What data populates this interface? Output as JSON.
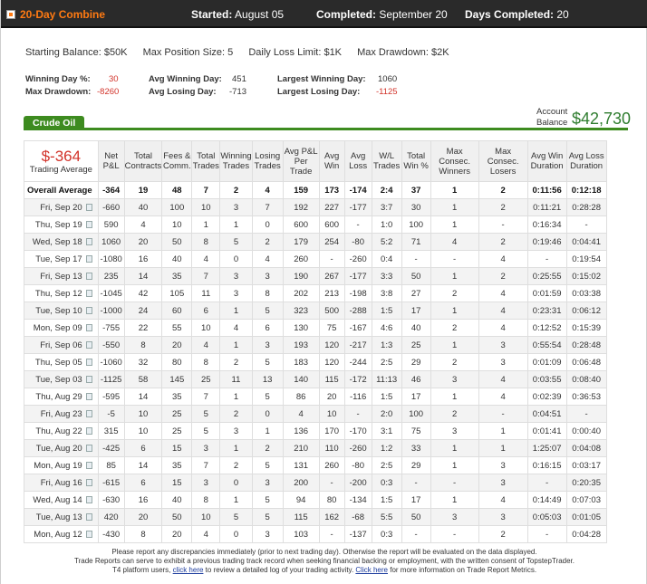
{
  "header": {
    "title": "20-Day Combine",
    "started_label": "Started:",
    "started_value": "August 05",
    "completed_label": "Completed:",
    "completed_value": "September 20",
    "days_label": "Days Completed:",
    "days_value": "20"
  },
  "summary": {
    "starting_balance": "Starting Balance: $50K",
    "max_position": "Max Position Size: 5",
    "daily_loss": "Daily Loss Limit: $1K",
    "max_drawdown": "Max Drawdown: $2K"
  },
  "stats": {
    "winning_day_pct_label": "Winning Day %:",
    "winning_day_pct_value": "30",
    "max_drawdown_label": "Max Drawdown:",
    "max_drawdown_value": "-8260",
    "avg_winning_day_label": "Avg Winning Day:",
    "avg_winning_day_value": "451",
    "avg_losing_day_label": "Avg Losing Day:",
    "avg_losing_day_value": "-713",
    "largest_winning_day_label": "Largest Winning Day:",
    "largest_winning_day_value": "1060",
    "largest_losing_day_label": "Largest Losing Day:",
    "largest_losing_day_value": "-1125"
  },
  "tab": {
    "label": "Crude Oil"
  },
  "account": {
    "label_line1": "Account",
    "label_line2": "Balance",
    "value": "$42,730"
  },
  "table": {
    "trading_average_value": "$-364",
    "trading_average_label": "Trading Average",
    "columns": [
      "Net P&L",
      "Total Contracts",
      "Fees & Comm.",
      "Total Trades",
      "Winning Trades",
      "Losing Trades",
      "Avg P&L Per Trade",
      "Avg Win",
      "Avg Loss",
      "W/L Trades",
      "Total Win %",
      "Max Consec. Winners",
      "Max Consec. Losers",
      "Avg Win Duration",
      "Avg Loss Duration"
    ],
    "overall": [
      "Overall Average",
      "-364",
      "19",
      "48",
      "7",
      "2",
      "4",
      "159",
      "173",
      "-174",
      "2:4",
      "37",
      "1",
      "2",
      "0:11:56",
      "0:12:18"
    ],
    "rows": [
      [
        "Fri, Sep 20",
        "-660",
        "40",
        "100",
        "10",
        "3",
        "7",
        "192",
        "227",
        "-177",
        "3:7",
        "30",
        "1",
        "2",
        "0:11:21",
        "0:28:28"
      ],
      [
        "Thu, Sep 19",
        "590",
        "4",
        "10",
        "1",
        "1",
        "0",
        "600",
        "600",
        "-",
        "1:0",
        "100",
        "1",
        "-",
        "0:16:34",
        "-"
      ],
      [
        "Wed, Sep 18",
        "1060",
        "20",
        "50",
        "8",
        "5",
        "2",
        "179",
        "254",
        "-80",
        "5:2",
        "71",
        "4",
        "2",
        "0:19:46",
        "0:04:41"
      ],
      [
        "Tue, Sep 17",
        "-1080",
        "16",
        "40",
        "4",
        "0",
        "4",
        "260",
        "-",
        "-260",
        "0:4",
        "-",
        "-",
        "4",
        "-",
        "0:19:54"
      ],
      [
        "Fri, Sep 13",
        "235",
        "14",
        "35",
        "7",
        "3",
        "3",
        "190",
        "267",
        "-177",
        "3:3",
        "50",
        "1",
        "2",
        "0:25:55",
        "0:15:02"
      ],
      [
        "Thu, Sep 12",
        "-1045",
        "42",
        "105",
        "11",
        "3",
        "8",
        "202",
        "213",
        "-198",
        "3:8",
        "27",
        "2",
        "4",
        "0:01:59",
        "0:03:38"
      ],
      [
        "Tue, Sep 10",
        "-1000",
        "24",
        "60",
        "6",
        "1",
        "5",
        "323",
        "500",
        "-288",
        "1:5",
        "17",
        "1",
        "4",
        "0:23:31",
        "0:06:12"
      ],
      [
        "Mon, Sep 09",
        "-755",
        "22",
        "55",
        "10",
        "4",
        "6",
        "130",
        "75",
        "-167",
        "4:6",
        "40",
        "2",
        "4",
        "0:12:52",
        "0:15:39"
      ],
      [
        "Fri, Sep 06",
        "-550",
        "8",
        "20",
        "4",
        "1",
        "3",
        "193",
        "120",
        "-217",
        "1:3",
        "25",
        "1",
        "3",
        "0:55:54",
        "0:28:48"
      ],
      [
        "Thu, Sep 05",
        "-1060",
        "32",
        "80",
        "8",
        "2",
        "5",
        "183",
        "120",
        "-244",
        "2:5",
        "29",
        "2",
        "3",
        "0:01:09",
        "0:06:48"
      ],
      [
        "Tue, Sep 03",
        "-1125",
        "58",
        "145",
        "25",
        "11",
        "13",
        "140",
        "115",
        "-172",
        "11:13",
        "46",
        "3",
        "4",
        "0:03:55",
        "0:08:40"
      ],
      [
        "Thu, Aug 29",
        "-595",
        "14",
        "35",
        "7",
        "1",
        "5",
        "86",
        "20",
        "-116",
        "1:5",
        "17",
        "1",
        "4",
        "0:02:39",
        "0:36:53"
      ],
      [
        "Fri, Aug 23",
        "-5",
        "10",
        "25",
        "5",
        "2",
        "0",
        "4",
        "10",
        "-",
        "2:0",
        "100",
        "2",
        "-",
        "0:04:51",
        "-"
      ],
      [
        "Thu, Aug 22",
        "315",
        "10",
        "25",
        "5",
        "3",
        "1",
        "136",
        "170",
        "-170",
        "3:1",
        "75",
        "3",
        "1",
        "0:01:41",
        "0:00:40"
      ],
      [
        "Tue, Aug 20",
        "-425",
        "6",
        "15",
        "3",
        "1",
        "2",
        "210",
        "110",
        "-260",
        "1:2",
        "33",
        "1",
        "1",
        "1:25:07",
        "0:04:08"
      ],
      [
        "Mon, Aug 19",
        "85",
        "14",
        "35",
        "7",
        "2",
        "5",
        "131",
        "260",
        "-80",
        "2:5",
        "29",
        "1",
        "3",
        "0:16:15",
        "0:03:17"
      ],
      [
        "Fri, Aug 16",
        "-615",
        "6",
        "15",
        "3",
        "0",
        "3",
        "200",
        "-",
        "-200",
        "0:3",
        "-",
        "-",
        "3",
        "-",
        "0:20:35"
      ],
      [
        "Wed, Aug 14",
        "-630",
        "16",
        "40",
        "8",
        "1",
        "5",
        "94",
        "80",
        "-134",
        "1:5",
        "17",
        "1",
        "4",
        "0:14:49",
        "0:07:03"
      ],
      [
        "Tue, Aug 13",
        "420",
        "20",
        "50",
        "10",
        "5",
        "5",
        "115",
        "162",
        "-68",
        "5:5",
        "50",
        "3",
        "3",
        "0:05:03",
        "0:01:05"
      ],
      [
        "Mon, Aug 12",
        "-430",
        "8",
        "20",
        "4",
        "0",
        "3",
        "103",
        "-",
        "-137",
        "0:3",
        "-",
        "-",
        "2",
        "-",
        "0:04:28"
      ]
    ]
  },
  "footer": {
    "line1": "Please report any discrepancies immediately (prior to next trading day). Otherwise the report will be evaluated on the data displayed.",
    "line2": "Trade Reports can serve to exhibit a previous trading track record when seeking financial backing or employment, with the written consent of TopstepTrader.",
    "line3_a": "T4 platform users,",
    "link1": "click here",
    "line3_b": "to review a detailed log of your trading activity.",
    "link2": "Click here",
    "line3_c": "for more information on Trade Report Metrics."
  }
}
